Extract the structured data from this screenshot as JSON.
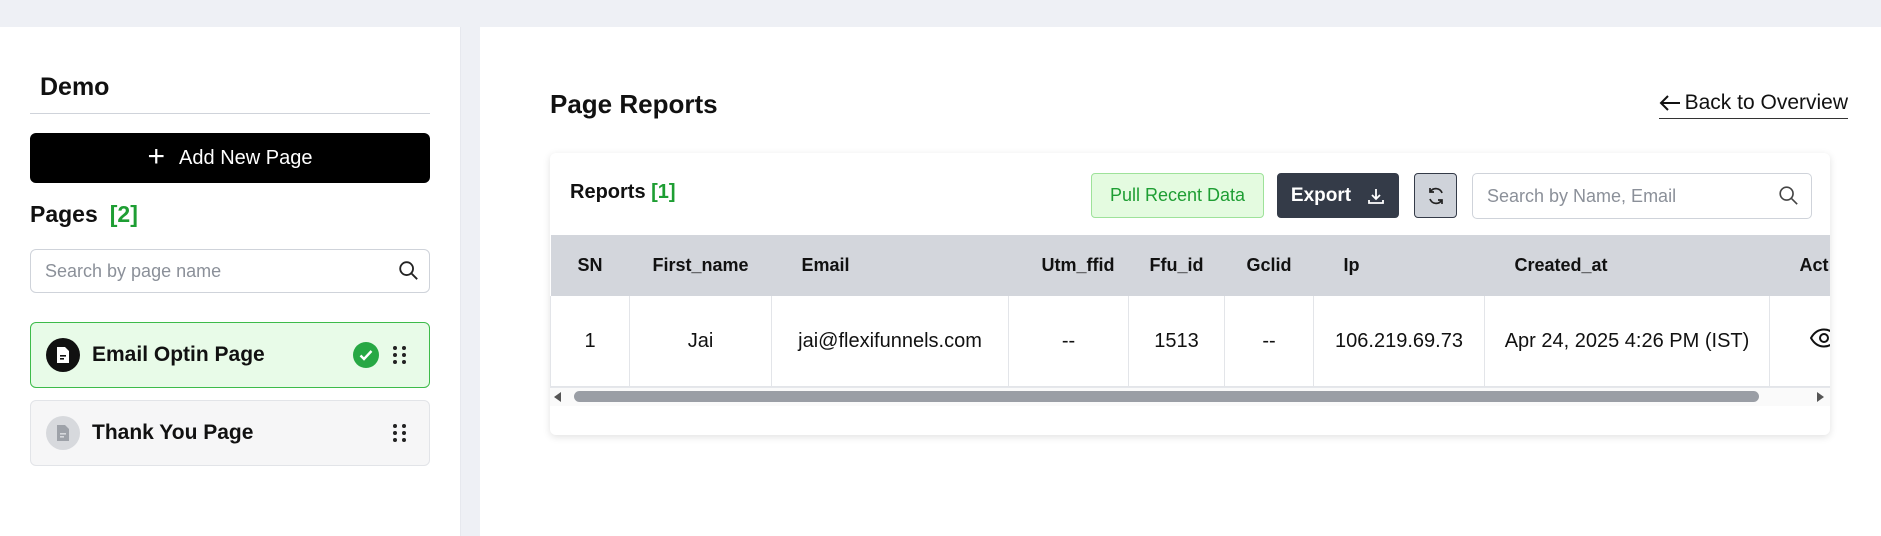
{
  "sidebar": {
    "project_name": "Demo",
    "add_button_label": "Add New Page",
    "pages_title": "Pages",
    "pages_count": "[2]",
    "search_placeholder": "Search by page name",
    "pages": [
      {
        "label": "Email Optin Page",
        "active": true,
        "published": true
      },
      {
        "label": "Thank You Page",
        "active": false,
        "published": false
      }
    ]
  },
  "main": {
    "title": "Page Reports",
    "back_label": "Back to Overview",
    "reports_title": "Reports",
    "reports_count": "[1]",
    "pull_button_label": "Pull Recent Data",
    "export_button_label": "Export",
    "search_placeholder": "Search by Name, Email",
    "table": {
      "columns": [
        "SN",
        "First_name",
        "Email",
        "Utm_ffid",
        "Ffu_id",
        "Gclid",
        "Ip",
        "Created_at",
        "Act"
      ],
      "rows": [
        [
          "1",
          "Jai",
          "jai@flexifunnels.com",
          "--",
          "1513",
          "--",
          "106.219.69.73",
          "Apr 24, 2025 4:26 PM (IST)",
          ""
        ]
      ]
    }
  },
  "colors": {
    "accent_green": "#1e9e33",
    "button_dark": "#343b48",
    "active_page_bg": "#e8fbe8"
  },
  "icons": [
    "plus-icon",
    "search-icon",
    "document-icon",
    "check-circle-icon",
    "drag-handle-icon",
    "arrow-left-icon",
    "download-icon",
    "refresh-icon",
    "eye-icon"
  ]
}
